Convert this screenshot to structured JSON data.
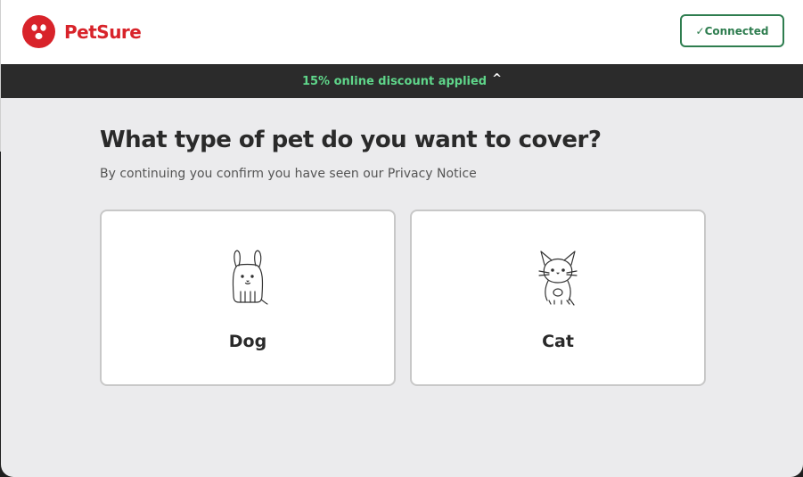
{
  "brand": {
    "name": "PetSure",
    "color": "#d8232a",
    "logo_icon": "paw-face-icon"
  },
  "status": {
    "label": "✓Connected",
    "color": "#2e7d4f"
  },
  "banner": {
    "text": "15% online discount applied",
    "toggle_icon": "^",
    "text_color": "#5fd68a"
  },
  "main": {
    "title": "What type of pet do you want to cover?",
    "subtitle": "By continuing you confirm you have seen our Privacy Notice",
    "options": [
      {
        "label": "Dog",
        "icon": "dog-icon"
      },
      {
        "label": "Cat",
        "icon": "cat-icon"
      }
    ]
  }
}
